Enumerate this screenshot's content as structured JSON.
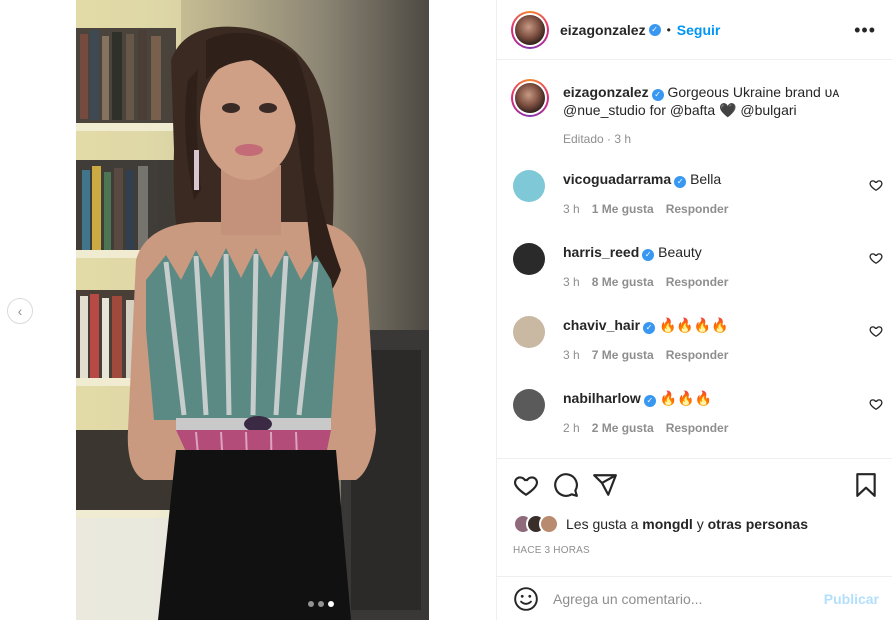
{
  "post": {
    "author": "eizagonzalez",
    "follow_label": "Seguir",
    "more_label": "•••",
    "dot_sep": "•",
    "caption_text": "Gorgeous Ukraine brand ᴜᴀ @nue_studio for @bafta 🖤 @bulgari",
    "edited_meta": "Editado · 3 h",
    "carousel_prev": "‹"
  },
  "comments": [
    {
      "user": "vicoguadarrama",
      "text": "Bella",
      "time": "3 h",
      "likes": "1 Me gusta",
      "reply": "Responder",
      "avatar_color": "#7fc8d8"
    },
    {
      "user": "harris_reed",
      "text": "Beauty",
      "time": "3 h",
      "likes": "8 Me gusta",
      "reply": "Responder",
      "avatar_color": "#2a2a2a"
    },
    {
      "user": "chaviv_hair",
      "text": "🔥🔥🔥🔥",
      "time": "3 h",
      "likes": "7 Me gusta",
      "reply": "Responder",
      "avatar_color": "#c9b8a2"
    },
    {
      "user": "nabilharlow",
      "text": "🔥🔥🔥",
      "time": "2 h",
      "likes": "2 Me gusta",
      "reply": "Responder",
      "avatar_color": "#5a5a5a"
    }
  ],
  "likes": {
    "prefix": "Les gusta a",
    "user": "mongdl",
    "middle": "y",
    "rest": "otras personas"
  },
  "timestamp": "HACE 3 HORAS",
  "composer": {
    "placeholder": "Agrega un comentario...",
    "publish_label": "Publicar"
  },
  "colors": {
    "accent": "#0095f6",
    "verified": "#3897f0",
    "muted": "#8e8e8e"
  }
}
